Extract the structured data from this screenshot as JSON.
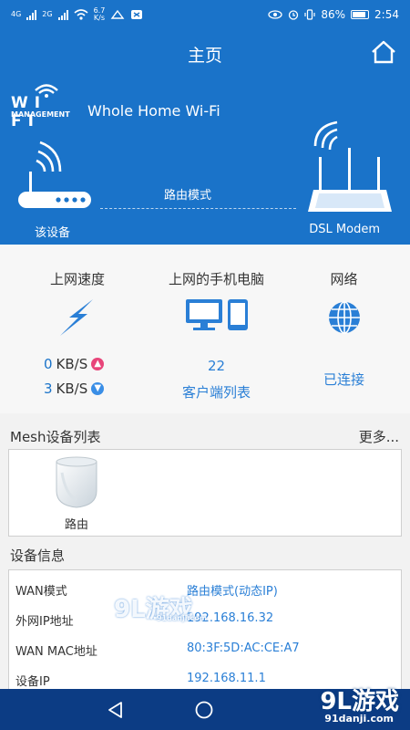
{
  "status_bar": {
    "net_1": "4G",
    "net_2": "2G",
    "speed_value": "6.7",
    "speed_unit": "K/s",
    "battery_percent": "86%",
    "time": "2:54"
  },
  "header": {
    "title": "主页",
    "logo_wifi": "WI FI",
    "logo_management": "MANAGEMENT",
    "brand": "Whole Home Wi-Fi",
    "left_device_label": "该设备",
    "right_device_label": "DSL Modem",
    "mode_label": "路由模式"
  },
  "stats": {
    "speed_title": "上网速度",
    "upload_value": "0",
    "download_value": "3",
    "speed_unit": "KB/S",
    "clients_title": "上网的手机电脑",
    "clients_count": "22",
    "clients_link": "客户端列表",
    "network_title": "网络",
    "network_status": "已连接"
  },
  "mesh": {
    "title": "Mesh设备列表",
    "more": "更多...",
    "items": [
      {
        "label": "路由"
      }
    ]
  },
  "device_info": {
    "title": "设备信息",
    "rows": [
      {
        "key": "WAN模式",
        "value": "路由模式(动态IP)"
      },
      {
        "key": "外网IP地址",
        "value": "192.168.16.32"
      },
      {
        "key": "WAN MAC地址",
        "value": "80:3F:5D:AC:CE:A7"
      },
      {
        "key": "设备IP",
        "value": "192.168.11.1"
      }
    ]
  },
  "watermark": {
    "center_main": "9L游戏",
    "center_sub": "91danji.com",
    "corner_main": "9L游戏",
    "corner_sub": "91danji.com"
  },
  "colors": {
    "primary": "#1a73c9",
    "link": "#2a7fd6",
    "nav_bar": "#0c3c84",
    "upload_badge": "#e8457a",
    "download_badge": "#3a8ee6"
  },
  "icons": {
    "home": "home-icon",
    "speed": "lightning-icon",
    "clients": "devices-icon",
    "network": "globe-icon",
    "router": "router-icon",
    "modem": "modem-icon",
    "mesh_node": "mesh-node-icon",
    "back": "back-triangle-icon",
    "nav_home": "circle-home-icon"
  }
}
